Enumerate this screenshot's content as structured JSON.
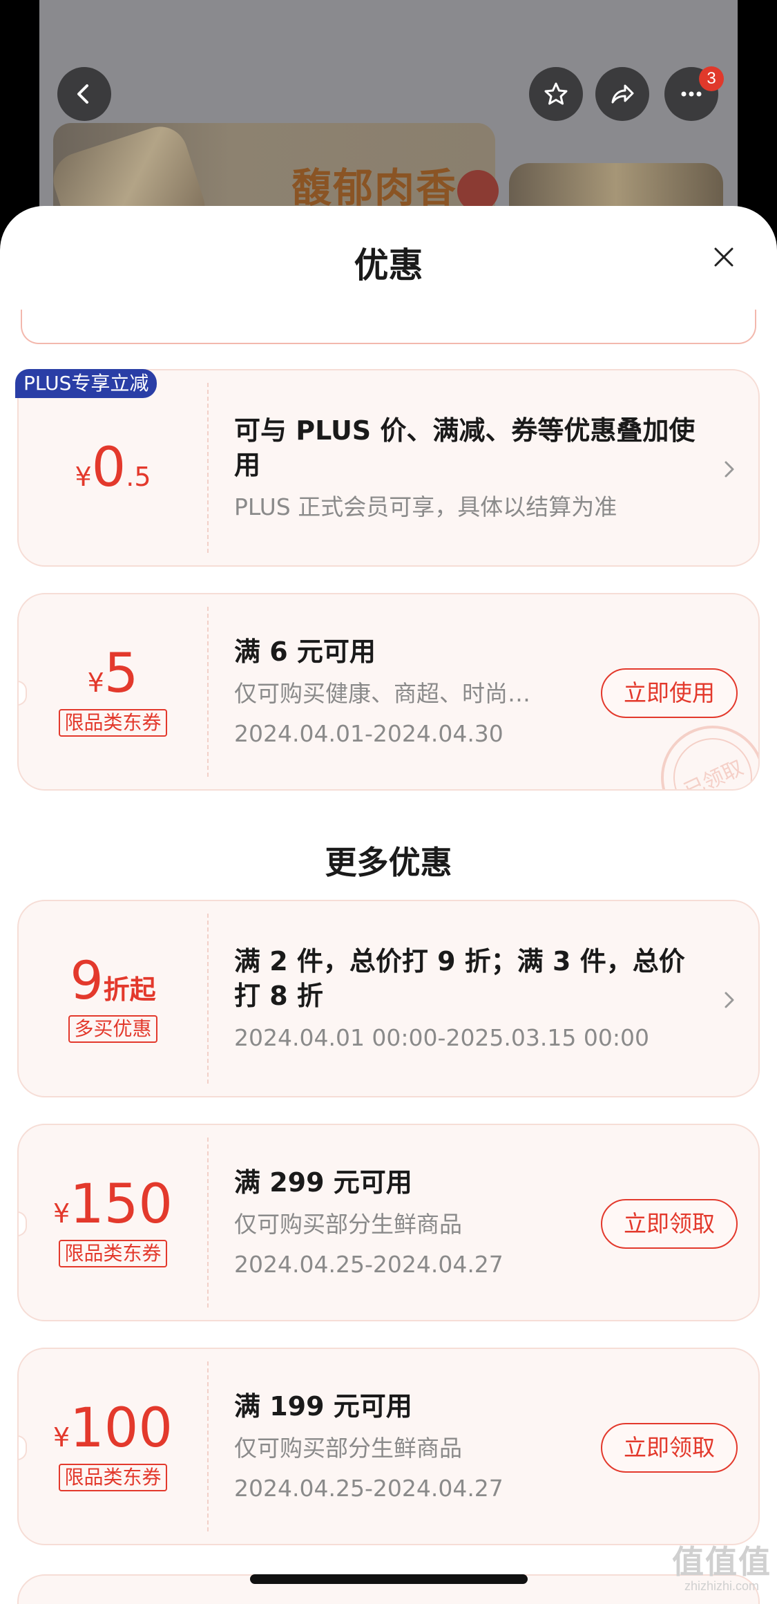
{
  "background": {
    "banner_text": "馥郁肉香",
    "notification_count": "3"
  },
  "sheet": {
    "title": "优惠"
  },
  "plus_card": {
    "badge": "PLUS专享立减",
    "currency": "¥",
    "amount_int": "0",
    "amount_dec": ".5",
    "title": "可与 PLUS 价、满减、券等优惠叠加使用",
    "subtitle": "PLUS 正式会员可享，具体以结算为准"
  },
  "coupon_received": {
    "currency": "¥",
    "amount": "5",
    "tag": "限品类东券",
    "condition": "满 6 元可用",
    "scope": "仅可购买健康、商超、时尚…",
    "validity": "2024.04.01-2024.04.30",
    "button": "立即使用",
    "stamp": "已领取"
  },
  "more_section": {
    "title": "更多优惠"
  },
  "discount_card": {
    "amount": "9",
    "unit": "折起",
    "tag": "多买优惠",
    "title": "满 2 件，总价打 9 折；满 3 件，总价打 8 折",
    "validity": "2024.04.01 00:00-2025.03.15 00:00"
  },
  "coupons": [
    {
      "currency": "¥",
      "amount": "150",
      "tag": "限品类东券",
      "condition": "满 299 元可用",
      "scope": "仅可购买部分生鲜商品",
      "validity": "2024.04.25-2024.04.27",
      "button": "立即领取"
    },
    {
      "currency": "¥",
      "amount": "100",
      "tag": "限品类东券",
      "condition": "满 199 元可用",
      "scope": "仅可购买部分生鲜商品",
      "validity": "2024.04.25-2024.04.27",
      "button": "立即领取"
    }
  ],
  "watermark": {
    "logo": "值值值",
    "url": "zhizhizhi.com"
  },
  "colors": {
    "accent": "#e3392c",
    "card_bg": "#fdf6f4",
    "plus_blue": "#2a3ea6"
  }
}
